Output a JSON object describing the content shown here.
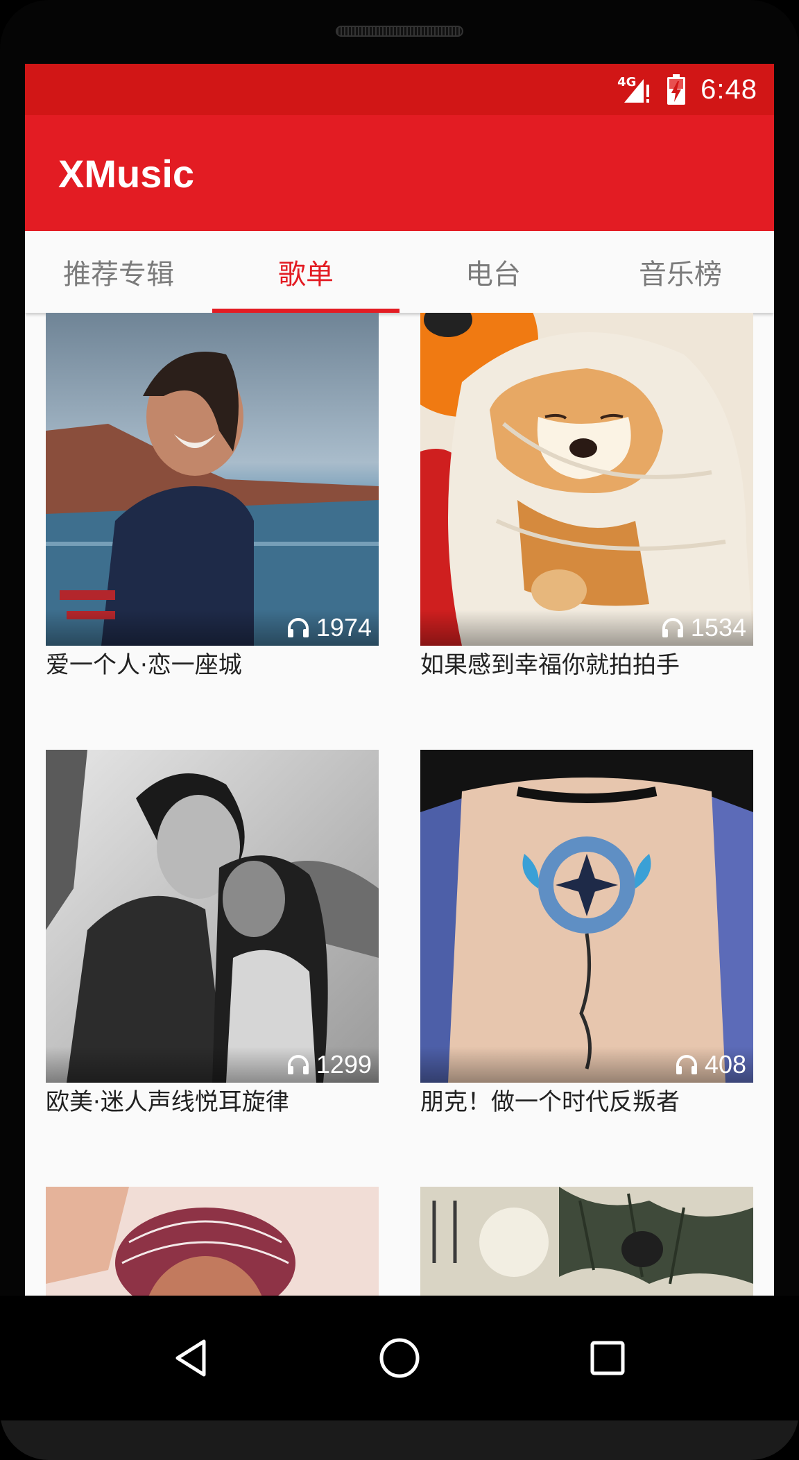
{
  "status_bar": {
    "network": "4G",
    "time": "6:48"
  },
  "app_bar": {
    "title": "XMusic"
  },
  "tabs": [
    {
      "label": "推荐专辑",
      "active": false
    },
    {
      "label": "歌单",
      "active": true
    },
    {
      "label": "电台",
      "active": false
    },
    {
      "label": "音乐榜",
      "active": false
    }
  ],
  "playlists": [
    {
      "title": "爱一个人·恋一座城",
      "play_count": "1974",
      "cover": "woman-by-lake-photo"
    },
    {
      "title": "如果感到幸福你就拍拍手",
      "play_count": "1534",
      "cover": "shiba-dog-blanket-photo"
    },
    {
      "title": "欧美·迷人声线悦耳旋律",
      "play_count": "1299",
      "cover": "couple-bw-photo"
    },
    {
      "title": "朋克！做一个时代反叛者",
      "play_count": "408",
      "cover": "back-tattoo-photo"
    },
    {
      "title": "",
      "play_count": "",
      "cover": "woman-veil-hat-photo"
    },
    {
      "title": "",
      "play_count": "",
      "cover": "chinese-ink-painting"
    }
  ],
  "colors": {
    "status_bar": "#d11616",
    "primary": "#e31c23",
    "tab_inactive": "#7b7b7b",
    "background": "#fafafa"
  },
  "icons": {
    "count": "headphones-icon",
    "nav_back": "back-triangle-icon",
    "nav_home": "home-circle-icon",
    "nav_recents": "recents-square-icon"
  }
}
